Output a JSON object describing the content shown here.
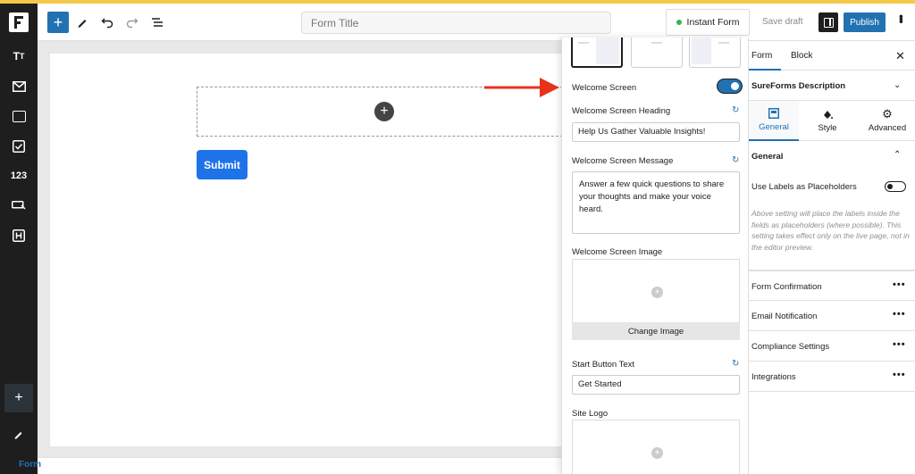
{
  "topbar": {
    "form_title_placeholder": "Form Title",
    "instant_form_label": "Instant Form",
    "save_draft_label": "Save draft",
    "publish_label": "Publish"
  },
  "leftbar": {
    "items": [
      {
        "icon": "text-icon",
        "glyph": "Tт"
      },
      {
        "icon": "email-icon"
      },
      {
        "icon": "input-field-icon"
      },
      {
        "icon": "checkbox-icon",
        "glyph": "☑"
      },
      {
        "icon": "number-icon",
        "glyph": "123"
      },
      {
        "icon": "button-icon"
      },
      {
        "icon": "heading-icon",
        "glyph": "H"
      }
    ]
  },
  "canvas": {
    "submit_label": "Submit"
  },
  "popover": {
    "welcome_screen_label": "Welcome Screen",
    "welcome_screen_enabled": true,
    "heading_label": "Welcome Screen Heading",
    "heading_value": "Help Us Gather Valuable Insights!",
    "message_label": "Welcome Screen Message",
    "message_value": "Answer a few quick questions to share your thoughts and make your voice heard.",
    "image_label": "Welcome Screen Image",
    "change_image_label": "Change Image",
    "start_button_label": "Start Button Text",
    "start_button_value": "Get Started",
    "site_logo_label": "Site Logo"
  },
  "sidebar": {
    "tabs": [
      "Form",
      "Block"
    ],
    "active_tab": "Form",
    "description_label": "SureForms Description",
    "sub_tabs": [
      {
        "label": "General",
        "icon": "general-icon"
      },
      {
        "label": "Style",
        "icon": "style-icon"
      },
      {
        "label": "Advanced",
        "icon": "gear-icon"
      }
    ],
    "active_sub_tab": "General",
    "general_section_label": "General",
    "placeholder_setting_label": "Use Labels as Placeholders",
    "placeholder_setting_enabled": false,
    "placeholder_help": "Above setting will place the labels inside the fields as placeholders (where possible). This setting takes effect only on the live page, not in the editor preview.",
    "sections": [
      "Form Confirmation",
      "Email Notification",
      "Compliance Settings",
      "Integrations"
    ]
  },
  "footer": {
    "breadcrumb": "Form"
  },
  "colors": {
    "accent": "#2271b1",
    "submit": "#1e73e8",
    "annotation_arrow": "#e8321e",
    "status_dot": "#35b556"
  }
}
